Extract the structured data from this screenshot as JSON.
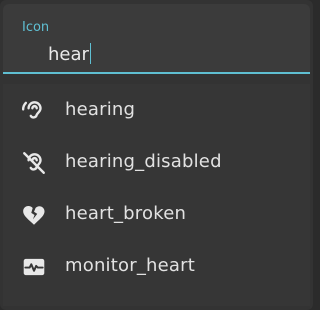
{
  "icon_field": {
    "label": "Icon",
    "value": "hear",
    "accent_color": "#5fbfd2"
  },
  "results": [
    {
      "label": "hearing",
      "icon": "hearing-icon"
    },
    {
      "label": "hearing_disabled",
      "icon": "hearing-disabled-icon"
    },
    {
      "label": "heart_broken",
      "icon": "heart-broken-icon"
    },
    {
      "label": "monitor_heart",
      "icon": "monitor-heart-icon"
    }
  ]
}
